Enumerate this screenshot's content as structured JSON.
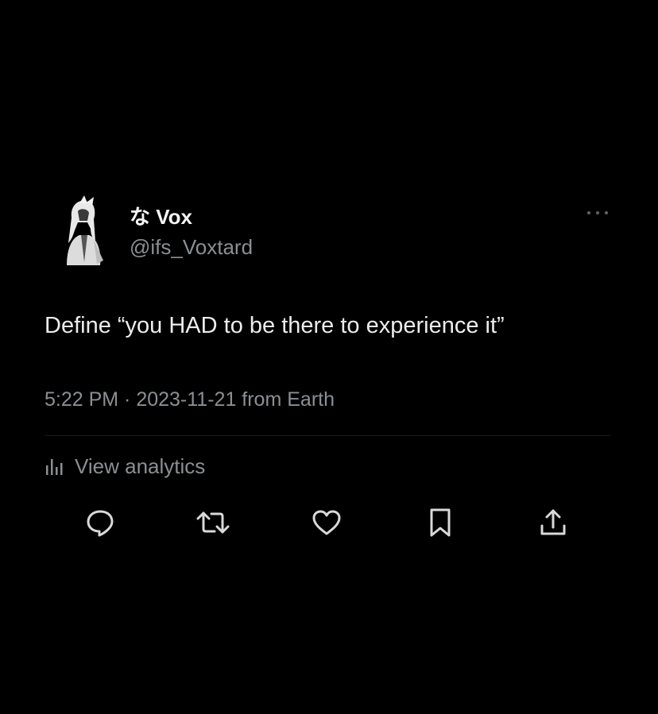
{
  "tweet": {
    "display_name": "な Vox",
    "handle": "@ifs_Voxtard",
    "text": "Define “you HAD to be there to experience it”",
    "timestamp": "5:22 PM · 2023-11-21 from Earth",
    "analytics_label": "View analytics"
  },
  "icons": {
    "more": "more-horizontal-icon",
    "analytics": "bar-chart-icon",
    "reply": "speech-bubble-icon",
    "retweet": "retweet-icon",
    "like": "heart-icon",
    "bookmark": "bookmark-icon",
    "share": "share-upload-icon"
  },
  "colors": {
    "background": "#000000",
    "primary_text": "#ececec",
    "secondary_text": "#8b8f93",
    "icon": "#d9d9d9",
    "divider": "#1a1a1a"
  }
}
